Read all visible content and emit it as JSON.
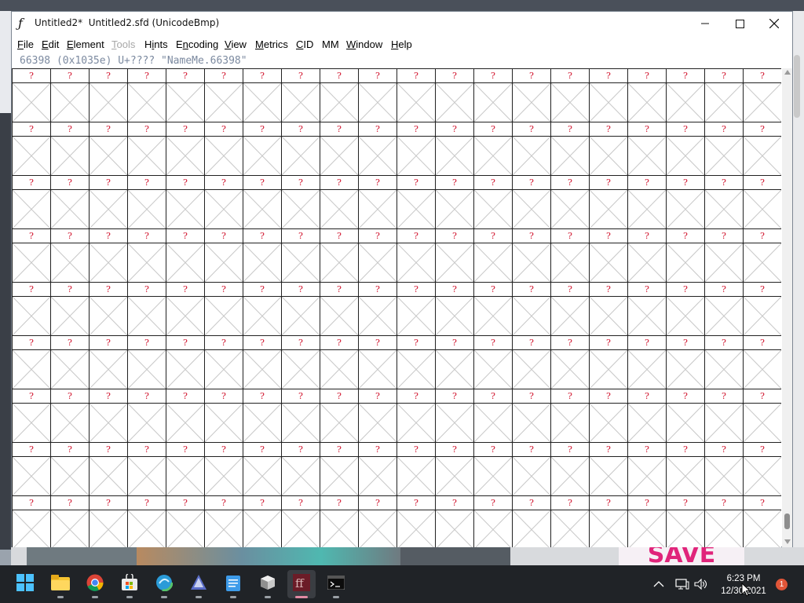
{
  "window": {
    "title": "Untitled2*  Untitled2.sfd (UnicodeBmp)",
    "app_icon": "fontforge-icon",
    "controls": [
      "minimize",
      "maximize",
      "close"
    ]
  },
  "menu": [
    {
      "label": "File",
      "u": "F",
      "rest": "ile",
      "disabled": false
    },
    {
      "label": "Edit",
      "u": "E",
      "rest": "dit",
      "disabled": false
    },
    {
      "label": "Element",
      "u": "E",
      "rest": "lement",
      "disabled": false
    },
    {
      "label": "Tools",
      "u": "T",
      "rest": "ools",
      "disabled": true
    },
    {
      "label": "Hints",
      "u": "i",
      "pre": "H",
      "rest": "nts",
      "disabled": false
    },
    {
      "label": "Encoding",
      "u": "n",
      "pre": "E",
      "rest": "coding",
      "disabled": false
    },
    {
      "label": "View",
      "u": "V",
      "rest": "iew",
      "disabled": false
    },
    {
      "label": "Metrics",
      "u": "M",
      "rest": "etrics",
      "disabled": false
    },
    {
      "label": "CID",
      "u": "C",
      "rest": "ID",
      "disabled": false
    },
    {
      "label": "MM",
      "u": "",
      "rest": "MM",
      "disabled": false
    },
    {
      "label": "Window",
      "u": "W",
      "rest": "indow",
      "disabled": false
    },
    {
      "label": "Help",
      "u": "H",
      "rest": "elp",
      "disabled": false
    }
  ],
  "info_line": "66398 (0x1035e) U+???? \"NameMe.66398\"",
  "glyph_grid": {
    "columns": 20,
    "rows": 9,
    "cell_label": "?",
    "cell_label_color": "#d0102a",
    "cell_state": "empty-placeholder"
  },
  "taskbar": {
    "apps": [
      {
        "name": "start-icon",
        "active": false
      },
      {
        "name": "file-explorer-icon",
        "active": false
      },
      {
        "name": "chrome-icon",
        "active": false
      },
      {
        "name": "microsoft-store-icon",
        "active": false
      },
      {
        "name": "edge-icon",
        "active": false
      },
      {
        "name": "inkscape-icon",
        "active": false
      },
      {
        "name": "notepad-icon",
        "active": false
      },
      {
        "name": "3d-viewer-icon",
        "active": false
      },
      {
        "name": "fontforge-icon",
        "active": true
      },
      {
        "name": "terminal-icon",
        "active": false
      }
    ],
    "time": "6:23 PM",
    "date": "12/30/2021",
    "notifications": "1"
  },
  "background": {
    "ad_text": "SAVE"
  },
  "colors": {
    "accent_taskbar": "#e38aa3",
    "info_text": "#7c8aa0"
  }
}
